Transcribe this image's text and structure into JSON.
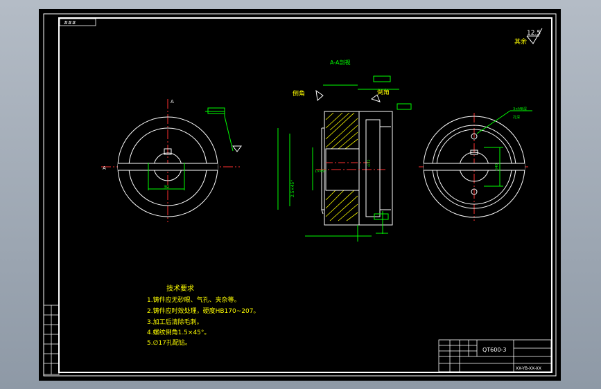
{
  "corner_stamp": "###",
  "surface_finish": {
    "value": "12.5",
    "label": "其余"
  },
  "section_title": "A-A剖视",
  "chamfer_left": "倒角",
  "chamfer_right": "倒角",
  "tech_requirements": {
    "title": "技术要求",
    "items": [
      "1.铸件应无砂眼、气孔、夹杂等。",
      "2.铸件应时效处理，硬度HB170~207。",
      "3.加工后清除毛刺。",
      "4.螺纹倒角1.5×45°。",
      "5.∅17孔配钻。"
    ]
  },
  "title_block": {
    "part_code": "QT600-3",
    "drawing_no": "XX-YB-XX-XX"
  },
  "dims": {
    "left_a": "A",
    "left_a2": "A",
    "dim_left_bottom": "30",
    "chamfer_note": "2.5×45°",
    "chamfer_small": "1×45°",
    "bore": "∅72",
    "bore_right": "∅40",
    "label_phi": "∅0.02",
    "thread_note": "3×M8深",
    "thread_sub": "孔深"
  },
  "colors": {
    "line": "#ffffff",
    "dim": "#00ff00",
    "center": "#ff3030",
    "hatch": "#ffff00",
    "background": "#000000"
  }
}
